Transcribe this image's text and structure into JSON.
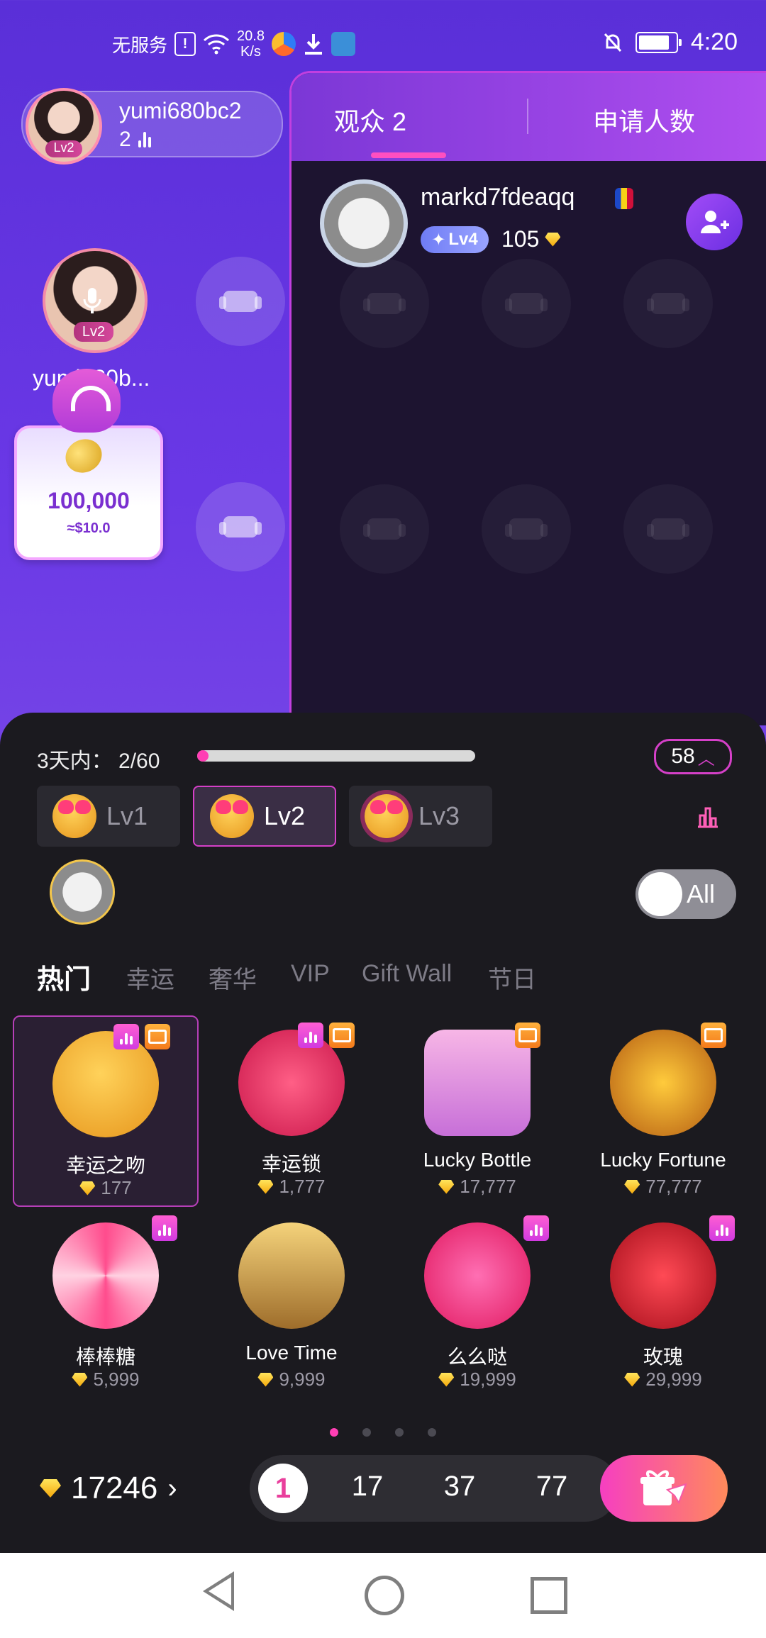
{
  "status_bar": {
    "carrier": "无服务",
    "sim_icon": "!",
    "speed_value": "20.8",
    "speed_unit": "K/s",
    "time": "4:20",
    "battery_level": 0.85
  },
  "host": {
    "name": "yumi680bc2",
    "level": "Lv2",
    "count": "2"
  },
  "mic_seat": {
    "name": "yumi680b...",
    "level": "Lv2"
  },
  "promo_card": {
    "amount": "100,000",
    "usd": "≈$10.0"
  },
  "audience_panel": {
    "tab_audience": "观众 2",
    "tab_applicants": "申请人数",
    "user": {
      "name": "markd7fdeaqq",
      "level": "Lv4",
      "value": "105"
    }
  },
  "gift_sheet": {
    "progress_label": "3天内：",
    "progress_value": "2/60",
    "progress_fraction": 0.033,
    "level_pill": "58",
    "level_tabs": [
      "Lv1",
      "Lv2",
      "Lv3"
    ],
    "selected_level": 1,
    "toggle_label": "All",
    "categories": [
      "热门",
      "幸运",
      "奢华",
      "VIP",
      "Gift Wall",
      "节日"
    ],
    "gifts": [
      {
        "name": "幸运之吻",
        "price": "177",
        "stat": true,
        "box": true
      },
      {
        "name": "幸运锁",
        "price": "1,777",
        "stat": true,
        "box": true
      },
      {
        "name": "Lucky Bottle",
        "price": "17,777",
        "stat": false,
        "box": true
      },
      {
        "name": "Lucky Fortune",
        "price": "77,777",
        "stat": false,
        "box": true
      },
      {
        "name": "棒棒糖",
        "price": "5,999",
        "stat": true,
        "box": false
      },
      {
        "name": "Love Time",
        "price": "9,999",
        "stat": false,
        "box": false
      },
      {
        "name": "么么哒",
        "price": "19,999",
        "stat": true,
        "box": false
      },
      {
        "name": "玫瑰",
        "price": "29,999",
        "stat": true,
        "box": false
      }
    ],
    "balance": "17246",
    "quantities": [
      "1",
      "17",
      "37",
      "77"
    ]
  },
  "colors": {
    "accent_pink": "#ff3fb4",
    "panel_bg": "#1b1a1f",
    "purple": "#6a38e6"
  }
}
